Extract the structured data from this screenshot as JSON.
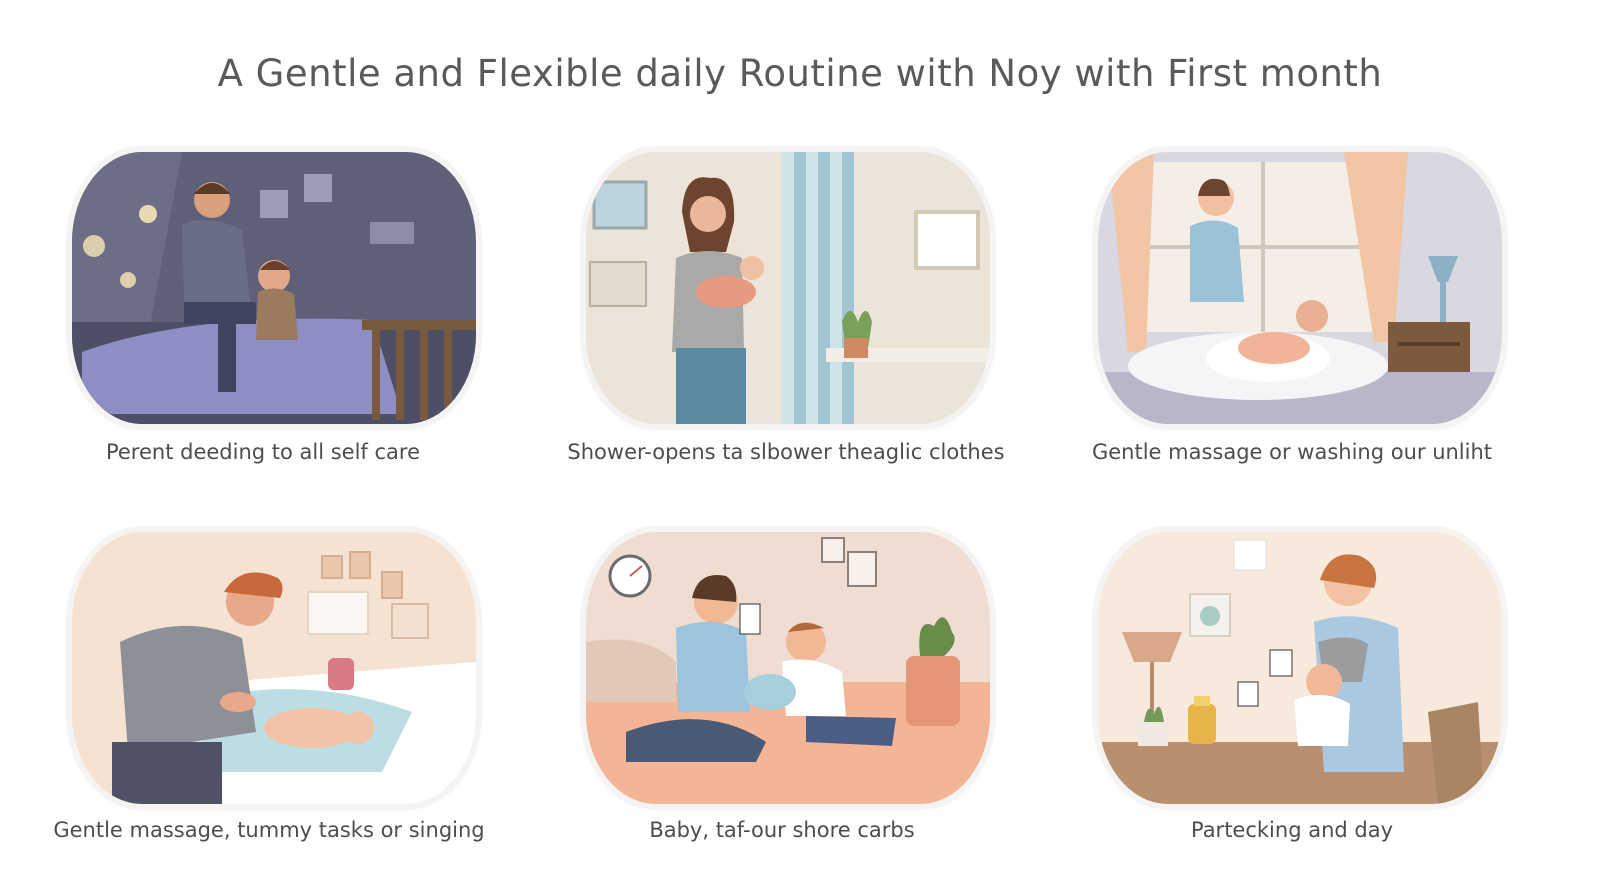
{
  "title": "A Gentle and Flexible daily Routine with Noy with First month",
  "cards": [
    {
      "caption": "Perent deeding to all self care",
      "scene": "father-baby-night-bedroom"
    },
    {
      "caption": "Shower-opens ta slbower theaglic clothes",
      "scene": "mother-holding-baby-bathroom"
    },
    {
      "caption": "Gentle massage or washing our unliht",
      "scene": "mother-massaging-baby-window"
    },
    {
      "caption": "Gentle massage, tummy tasks or singing",
      "scene": "father-changing-baby"
    },
    {
      "caption": "Baby, taf-our shore carbs",
      "scene": "mother-playing-cards-with-baby"
    },
    {
      "caption": "Partecking and day",
      "scene": "mother-feeding-baby-table"
    }
  ]
}
